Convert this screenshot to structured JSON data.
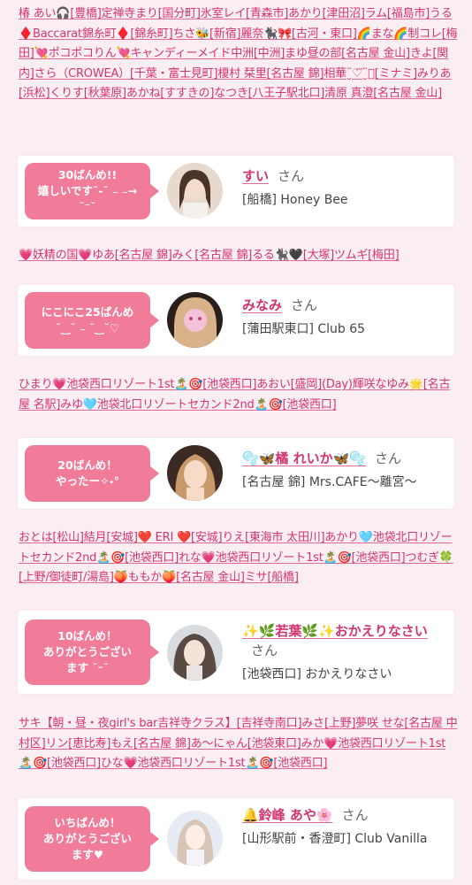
{
  "name_blocks": [
    {
      "text": "椿 あい🎧[豊橋]定禅寺まり[国分町]氷室レイ[青森市]あかり[津田沼]ラム[福島市]うる♦️Baccarat錦糸町♦️[錦糸町]ちさ🐝[新宿]麗奈🐈‍⬛🎀[古河・東口]🌈まな🌈制コレ[梅田]💘ポコポコりん💘キャンディーメイド中洲[中洲]まゆ昼の部[名古屋 金山]きよ[関内]さら（CROWEA）[千葉・富士見町]榎村 栞里[名古屋 錦]相華¨̮♡⃛¨̮⃝[ミナミ]みりあ[浜松]くりす[秋葉原]あかね[すすきの]なつき[八王子駅北口]清原 真澄[名古屋 金山]"
    },
    {
      "text": "💗妖精の国💗ゆあ[名古屋 錦]みく[名古屋 錦]るる🐈‍⬛🖤[大塚]ツムギ[梅田]"
    },
    {
      "text": "ひまり💗池袋西口リゾート1st🏝️🎯[池袋西口]あおい[盛岡](Day)輝咲なゆみ🌟[名古屋 名駅]みゆ🩵池袋北口リゾートセカンド2nd🏝️🎯[池袋西口]"
    },
    {
      "text": "おとは[松山]結月[安城]❤️ ERI ❤️[安城]りえ[東海市 太田川]あかり🩵池袋北口リゾートセカンド2nd🏝️🎯[池袋西口]れな💗池袋西口リゾート1st🏝️🎯[池袋西口]つむぎ🍀[上野/御徒町/湯島]🍑ももか🍑[名古屋 金山]ミサ[船橋]"
    },
    {
      "text": "サキ【朝・昼・夜girl's bar吉祥寺クラス】[吉祥寺南口]みさ[上野]夢咲 せな[名古屋 中村区]リン[恵比寿]もえ[名古屋 錦]あ〜にゃん[池袋東口]みか💗池袋西口リゾート1st🏝️🎯[池袋西口]ひな💗池袋西口リゾート1st🏝️🎯[池袋西口]"
    }
  ],
  "cards": [
    {
      "badge": "30ばんめ!!\n嬉しいです˘‐˘ ₋ ₋→ ˘⁻˘",
      "name": "すい",
      "suffix": "さん",
      "shop": "[船橋] Honey Bee"
    },
    {
      "badge": "にこにこ25ばんめ\n˘‿˘ ₋ ˘‿˘♡",
      "name": "みなみ",
      "suffix": "さん",
      "shop": "[蒲田駅東口] Club 65"
    },
    {
      "badge": "20ばんめ！\nやったー✧˖°",
      "name": "🫧🦋橘 れいか🦋🫧",
      "suffix": "さん",
      "shop": "[名古屋 錦] Mrs.CAFE〜離宮〜"
    },
    {
      "badge": "10ばんめ！\nありがとうござい\nます ˘ᵕ˘",
      "name": "✨🌿若葉🌿✨おかえりなさい",
      "suffix": "さん",
      "shop": "[池袋西口] おかえりなさい"
    },
    {
      "badge": "いちばんめ！\nありがとうござい\nます♥",
      "name": "🔔鈴峰 あや🌸",
      "suffix": "さん",
      "shop": "[山形駅前・香澄町] Club Vanilla"
    }
  ]
}
